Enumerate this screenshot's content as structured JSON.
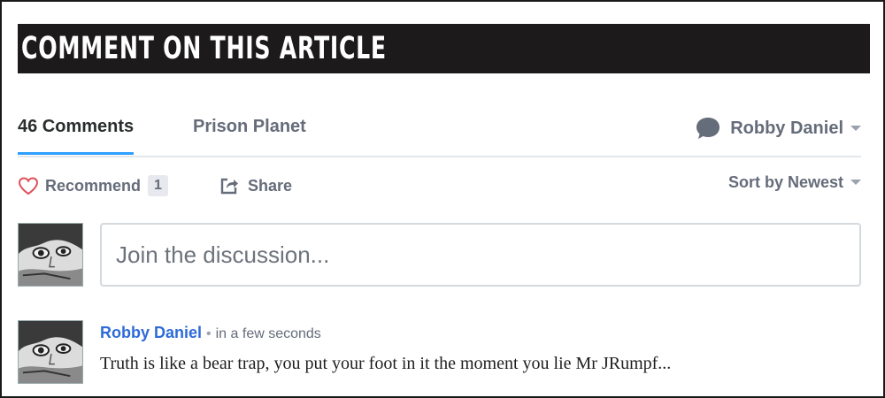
{
  "banner": {
    "title": "COMMENT ON THIS ARTICLE"
  },
  "tabs": {
    "comments_label": "46 Comments",
    "community_label": "Prison Planet",
    "user_name": "Robby Daniel"
  },
  "actions": {
    "recommend_label": "Recommend",
    "recommend_count": "1",
    "share_label": "Share",
    "sort_label": "Sort by Newest"
  },
  "composer": {
    "placeholder": "Join the discussion..."
  },
  "comment": {
    "author": "Robby Daniel",
    "separator": "•",
    "time": "in a few seconds",
    "text": "Truth is like a bear trap, you put your foot in it the moment you lie Mr JRumpf..."
  },
  "colors": {
    "banner_bg": "#1c1a1b",
    "active_tab_underline": "#2e9fff",
    "author_link": "#2e6bd8",
    "heart": "#e0505a",
    "muted_text": "#656c7a"
  },
  "icons": [
    "chat-bubble-icon",
    "heart-icon",
    "share-icon",
    "caret-down-icon",
    "avatar-image"
  ]
}
